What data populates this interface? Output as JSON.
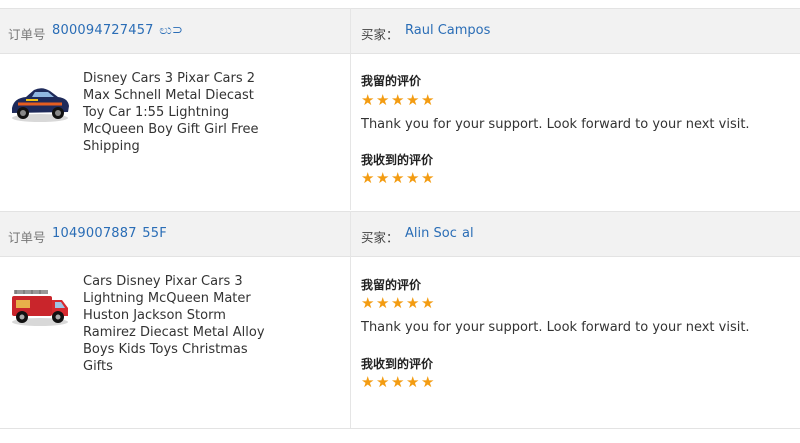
{
  "orders": [
    {
      "order_label": "订单号",
      "order_number": "800094727457  ಲು⊃",
      "buyer_label": "买家：",
      "buyer_name": "Raul Campos",
      "product_title": "Disney Cars 3 Pixar Cars 2 Max Schnell Metal Diecast Toy Car 1:55 Lightning McQueen Boy Gift Girl Free Shipping",
      "my_review_label": "我留的评价",
      "my_review_stars": 5,
      "my_review_text": "Thank you for your support. Look forward to your next visit.",
      "received_review_label": "我收到的评价",
      "received_review_stars": 5,
      "thumbnail_icon": "toy-car-icon"
    },
    {
      "order_label": "订单号",
      "order_number": "1049007887  55F",
      "buyer_label": "买家：",
      "buyer_name": "Alin Soc  al",
      "product_title": "Cars Disney Pixar Cars 3 Lightning McQueen Mater Huston Jackson Storm Ramirez Diecast Metal Alloy Boys Kids Toys Christmas Gifts",
      "my_review_label": "我留的评价",
      "my_review_stars": 5,
      "my_review_text": "Thank you for your support. Look forward to your next visit.",
      "received_review_label": "我收到的评价",
      "received_review_stars": 5,
      "thumbnail_icon": "fire-truck-icon"
    }
  ],
  "colors": {
    "link": "#2a6db6",
    "star": "#f39c12",
    "header_bg": "#f2f2f2"
  }
}
